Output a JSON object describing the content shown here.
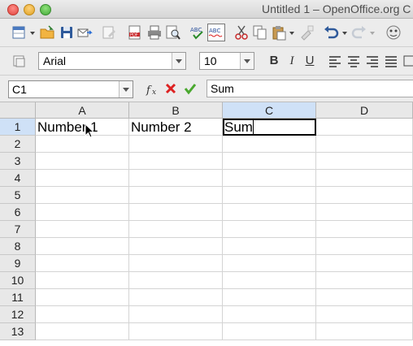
{
  "window": {
    "title": "Untitled 1 – OpenOffice.org C"
  },
  "toolbar": {
    "font_name": "Arial",
    "font_size": "10",
    "bold": "B",
    "italic": "I",
    "underline": "U",
    "icons": [
      "new-document-icon",
      "open-folder-icon",
      "save-icon",
      "email-icon",
      "edit-file-icon",
      "pdf-export-icon",
      "print-icon",
      "page-preview-icon",
      "spellcheck-icon",
      "autospellcheck-icon",
      "cut-icon",
      "copy-icon",
      "paste-icon",
      "clone-format-icon",
      "undo-icon",
      "redo-icon",
      "navigator-icon"
    ]
  },
  "formula_bar": {
    "name_box": "C1",
    "input": "Sum"
  },
  "sheet": {
    "columns": [
      "A",
      "B",
      "C",
      "D"
    ],
    "rows": [
      "1",
      "2",
      "3",
      "4",
      "5",
      "6",
      "7",
      "8",
      "9",
      "10",
      "11",
      "12",
      "13"
    ],
    "cells": {
      "A1": "Number 1",
      "B1": "Number 2",
      "C1": "Sum"
    },
    "active_cell": "C1"
  },
  "colors": {
    "selected_header": "#cfe1f7",
    "grid": "#d4d4d4"
  }
}
